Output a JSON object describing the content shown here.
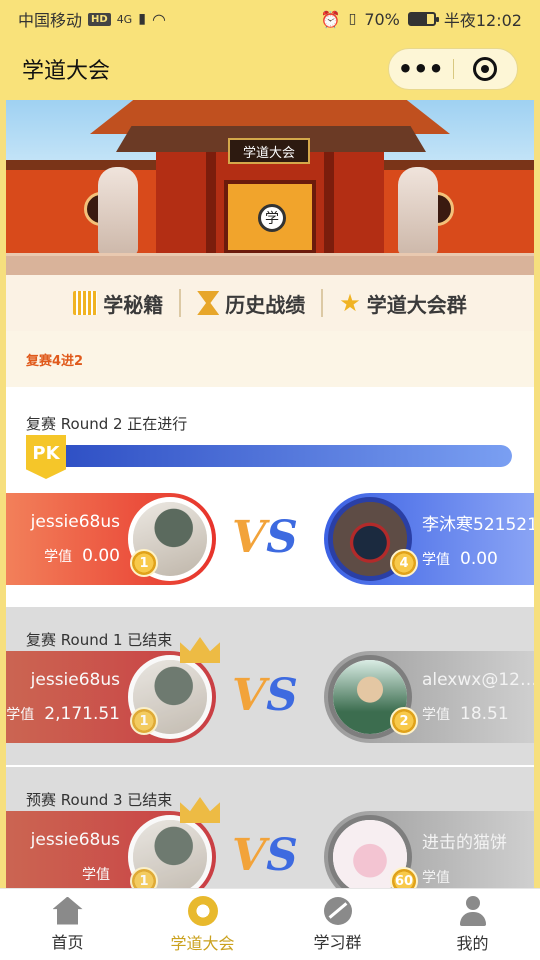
{
  "status_bar": {
    "carrier": "中国移动",
    "hd": "HD",
    "network": "4G",
    "battery": "70%",
    "battery_fraction": 0.7,
    "time": "半夜12:02"
  },
  "header": {
    "title": "学道大会",
    "menu_label": "•••"
  },
  "banner": {
    "sign_text": "学道大会",
    "seal_text": "学"
  },
  "nav": {
    "items": [
      {
        "label": "学秘籍",
        "icon": "book-icon"
      },
      {
        "label": "历史战绩",
        "icon": "hourglass-icon"
      },
      {
        "label": "学道大会群",
        "icon": "star-icon"
      }
    ]
  },
  "section": {
    "title": "复赛4进2"
  },
  "matches": [
    {
      "title": "复赛 Round 2 正在进行",
      "pk_label": "PK",
      "progress_fraction": 1.0,
      "left": {
        "name": "jessie68us",
        "score_label": "学值",
        "score": "0.00",
        "rank": "1",
        "avatar": "umbrella-avatar"
      },
      "right": {
        "name": "李沐寒521521",
        "score_label": "学值",
        "score": "0.00",
        "rank": "4",
        "avatar": "medal-avatar"
      }
    },
    {
      "title": "复赛 Round 1 已结束",
      "left": {
        "name": "jessie68us",
        "score_label": "学值",
        "score": "2,171.51",
        "rank": "1",
        "avatar": "umbrella-avatar",
        "crown": true
      },
      "right": {
        "name": "alexwx@12…",
        "score_label": "学值",
        "score": "18.51",
        "rank": "2",
        "avatar": "warrior-avatar"
      }
    },
    {
      "title": "预赛 Round 3 已结束",
      "left": {
        "name": "jessie68us",
        "score_label": "学值",
        "score": "",
        "rank": "1",
        "avatar": "umbrella-avatar",
        "crown": true
      },
      "right": {
        "name": "进击的猫饼",
        "score_label": "学值",
        "score": "",
        "rank": "60",
        "avatar": "bunny-avatar"
      }
    }
  ],
  "vs_text": {
    "v": "V",
    "s": "S"
  },
  "tabbar": {
    "items": [
      {
        "label": "首页",
        "icon": "home-icon",
        "active": false
      },
      {
        "label": "学道大会",
        "icon": "meeting-icon",
        "active": true
      },
      {
        "label": "学习群",
        "icon": "group-icon",
        "active": false
      },
      {
        "label": "我的",
        "icon": "me-icon",
        "active": false
      }
    ]
  },
  "colors": {
    "theme_yellow": "#f9e27a",
    "accent_orange": "#e05a1c",
    "active_tab": "#caa11e",
    "red_player": "#e7332b",
    "blue_player": "#3b61e4"
  }
}
